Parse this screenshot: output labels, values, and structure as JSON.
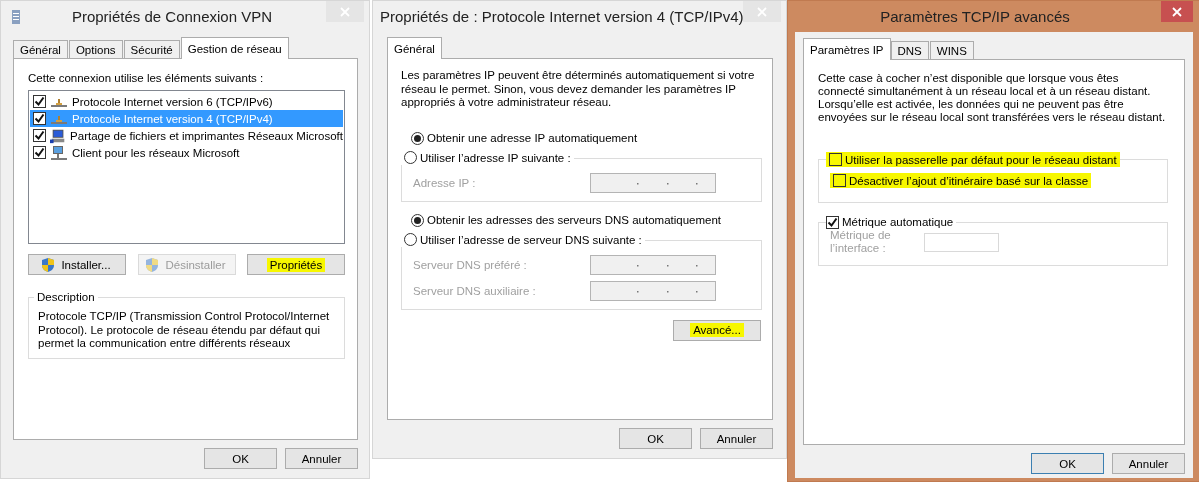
{
  "vpn_dialog": {
    "title": "Propriétés de Connexion VPN",
    "active": false,
    "tabs": [
      {
        "label": "Général",
        "selected": false
      },
      {
        "label": "Options",
        "selected": false
      },
      {
        "label": "Sécurité",
        "selected": false
      },
      {
        "label": "Gestion de réseau",
        "selected": true
      }
    ],
    "list_label": "Cette connexion utilise les éléments suivants :",
    "components": [
      {
        "label": "Protocole Internet version 6 (TCP/IPv6)",
        "checked": true,
        "selected": false,
        "kind": "protocol"
      },
      {
        "label": "Protocole Internet version 4 (TCP/IPv4)",
        "checked": true,
        "selected": true,
        "kind": "protocol"
      },
      {
        "label": "Partage de fichiers et imprimantes Réseaux Microsoft",
        "checked": true,
        "selected": false,
        "kind": "sharing"
      },
      {
        "label": "Client pour les réseaux Microsoft",
        "checked": true,
        "selected": false,
        "kind": "client"
      }
    ],
    "buttons": [
      {
        "label": "Installer...",
        "disabled": false,
        "highlighted": false,
        "kind": "shield"
      },
      {
        "label": "Désinstaller",
        "disabled": true,
        "highlighted": false,
        "kind": "shield"
      },
      {
        "label": "Propriétés",
        "disabled": false,
        "highlighted": true,
        "kind": "plain"
      }
    ],
    "description": {
      "legend": "Description",
      "text": "Protocole TCP/IP (Transmission Control Protocol/Internet Protocol). Le protocole de réseau étendu par défaut qui permet la communication entre différents réseaux"
    },
    "footer_buttons": [
      {
        "label": "OK",
        "default": false
      },
      {
        "label": "Annuler",
        "default": false
      }
    ]
  },
  "ipv4_dialog": {
    "title": "Propriétés de : Protocole Internet version 4 (TCP/IPv4)",
    "active": false,
    "tabs": [
      {
        "label": "Général",
        "selected": true
      }
    ],
    "intro": "Les paramètres IP peuvent être déterminés automatiquement si votre réseau le permet. Sinon, vous devez demander les paramètres IP appropriés à votre administrateur réseau.",
    "sections": [
      {
        "auto_option": {
          "label": "Obtenir une adresse IP automatiquement",
          "selected": true
        },
        "manual_option": {
          "label": "Utiliser l’adresse IP suivante :",
          "selected": false
        },
        "fields": [
          {
            "label": "Adresse IP :",
            "disabled": true
          }
        ]
      },
      {
        "auto_option": {
          "label": "Obtenir les adresses des serveurs DNS automatiquement",
          "selected": true
        },
        "manual_option": {
          "label": "Utiliser l’adresse de serveur DNS suivante :",
          "selected": false
        },
        "fields": [
          {
            "label": "Serveur DNS préféré :",
            "disabled": true
          },
          {
            "label": "Serveur DNS auxiliaire :",
            "disabled": true
          }
        ]
      }
    ],
    "advanced_button": {
      "label": "Avancé...",
      "highlighted": true
    },
    "footer_buttons": [
      {
        "label": "OK",
        "default": false
      },
      {
        "label": "Annuler",
        "default": false
      }
    ]
  },
  "advanced_dialog": {
    "title": "Paramètres TCP/IP avancés",
    "active": true,
    "tabs": [
      {
        "label": "Paramètres IP",
        "selected": true
      },
      {
        "label": "DNS",
        "selected": false
      },
      {
        "label": "WINS",
        "selected": false
      }
    ],
    "intro": "Cette case à cocher n’est disponible que lorsque vous êtes connecté simultanément à un réseau local et à un réseau distant. Lorsqu’elle est activée, les données qui ne peuvent pas être envoyées sur le réseau local sont transférées vers le réseau distant.",
    "gateway_options": [
      {
        "label": "Utiliser la passerelle par défaut pour le réseau distant",
        "checked": false,
        "highlighted": true
      },
      {
        "label": "Désactiver l’ajout d’itinéraire basé sur la classe",
        "checked": false,
        "highlighted": true
      }
    ],
    "metric": {
      "option": {
        "label": "Métrique automatique",
        "checked": true
      },
      "field_label": "Métrique de l’interface :",
      "disabled": true
    },
    "footer_buttons": [
      {
        "label": "OK",
        "default": true
      },
      {
        "label": "Annuler",
        "default": false
      }
    ]
  }
}
